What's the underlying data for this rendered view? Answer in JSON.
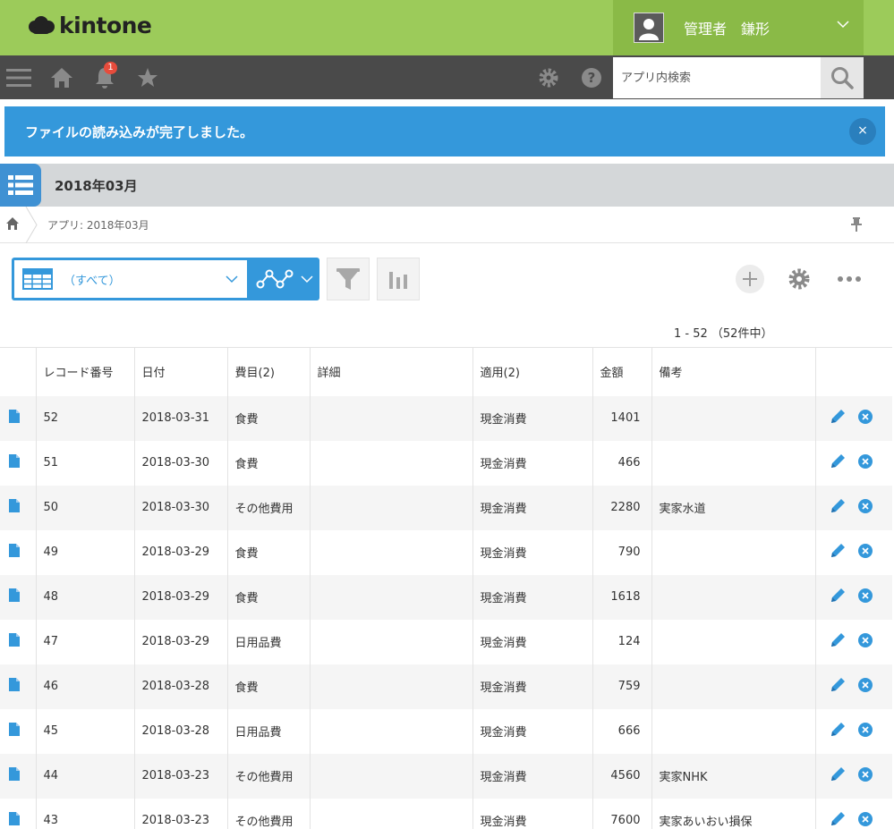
{
  "header": {
    "logo_text": "kintone",
    "user_name": "管理者　鎌形"
  },
  "toolbar": {
    "notification_count": "1",
    "search_placeholder": "アプリ内検索"
  },
  "notice": {
    "message": "ファイルの読み込みが完了しました。",
    "close_glyph": "×"
  },
  "app": {
    "title": "2018年03月",
    "breadcrumb": "アプリ: 2018年03月"
  },
  "view": {
    "selected": "（すべて）"
  },
  "pager": {
    "text": "1 - 52 （52件中）"
  },
  "table": {
    "columns": [
      "",
      "レコード番号",
      "日付",
      "費目(2)",
      "詳細",
      "適用(2)",
      "金額",
      "備考",
      ""
    ],
    "rows": [
      [
        "52",
        "2018-03-31",
        "食費",
        "",
        "現金消費",
        "1401",
        ""
      ],
      [
        "51",
        "2018-03-30",
        "食費",
        "",
        "現金消費",
        "466",
        ""
      ],
      [
        "50",
        "2018-03-30",
        "その他費用",
        "",
        "現金消費",
        "2280",
        "実家水道"
      ],
      [
        "49",
        "2018-03-29",
        "食費",
        "",
        "現金消費",
        "790",
        ""
      ],
      [
        "48",
        "2018-03-29",
        "食費",
        "",
        "現金消費",
        "1618",
        ""
      ],
      [
        "47",
        "2018-03-29",
        "日用品費",
        "",
        "現金消費",
        "124",
        ""
      ],
      [
        "46",
        "2018-03-28",
        "食費",
        "",
        "現金消費",
        "759",
        ""
      ],
      [
        "45",
        "2018-03-28",
        "日用品費",
        "",
        "現金消費",
        "666",
        ""
      ],
      [
        "44",
        "2018-03-23",
        "その他費用",
        "",
        "現金消費",
        "4560",
        "実家NHK"
      ],
      [
        "43",
        "2018-03-23",
        "その他費用",
        "",
        "現金消費",
        "7600",
        "実家あいおい損保"
      ]
    ]
  },
  "colors": {
    "header_green": "#9ccb5a",
    "accent_blue": "#3498db",
    "toolbar_gray": "#4a4a4a"
  },
  "icons": [
    "menu-icon",
    "home-icon",
    "bell-icon",
    "star-icon",
    "gear-icon",
    "help-icon",
    "search-icon",
    "list-icon",
    "pin-icon",
    "graph-icon",
    "filter-icon",
    "chart-icon",
    "add-icon",
    "more-icon",
    "document-icon",
    "edit-icon",
    "delete-icon"
  ]
}
